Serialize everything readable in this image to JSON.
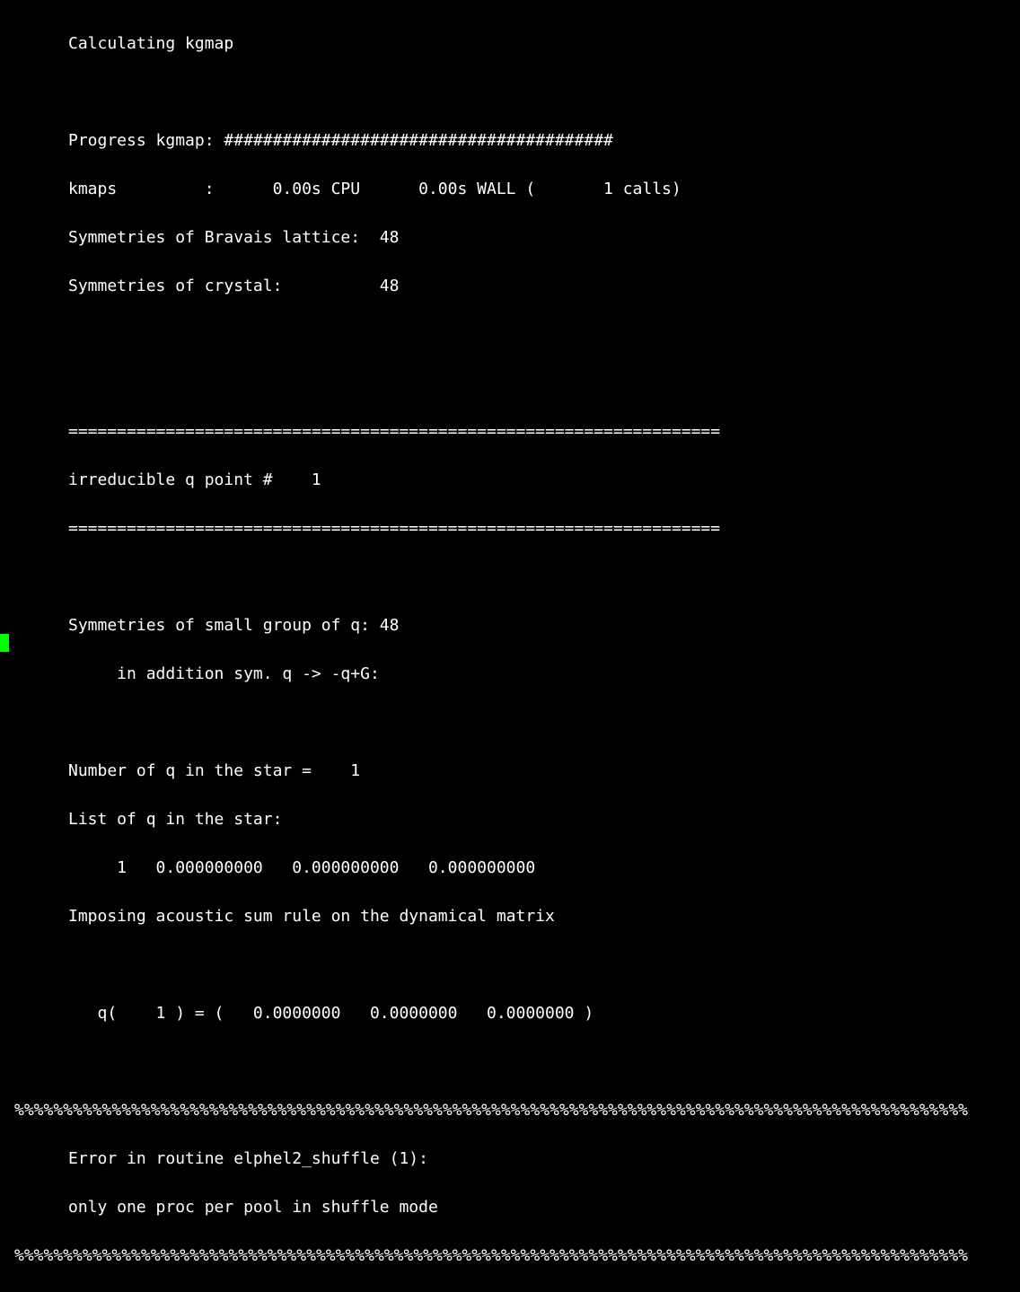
{
  "lines": {
    "calculating": "Calculating kgmap",
    "blank": "",
    "progress": "Progress kgmap: ########################################",
    "kmaps": "kmaps         :      0.00s CPU      0.00s WALL (       1 calls)",
    "sym_bravais": "Symmetries of Bravais lattice:  48",
    "sym_crystal": "Symmetries of crystal:          48",
    "divider_eq": "===================================================================",
    "irreducible": "irreducible q point #    1",
    "sym_small_group": "Symmetries of small group of q: 48",
    "addition_sym": "     in addition sym. q -> -q+G:",
    "num_q_star": "Number of q in the star =    1",
    "list_q_star": "List of q in the star:",
    "q_star_1": "     1   0.000000000   0.000000000   0.000000000",
    "imposing": "Imposing acoustic sum rule on the dynamical matrix",
    "q_vec": "   q(    1 ) = (   0.0000000   0.0000000   0.0000000 )",
    "pct_divider": "%%%%%%%%%%%%%%%%%%%%%%%%%%%%%%%%%%%%%%%%%%%%%%%%%%%%%%%%%%%%%%%%%%%%%%%%%%%%%%%%%%%%%%%%%%%%%%%%%%",
    "error_routine": "Error in routine elphel2_shuffle (1):",
    "error_msg": "only one proc per pool in shuffle mode"
  }
}
